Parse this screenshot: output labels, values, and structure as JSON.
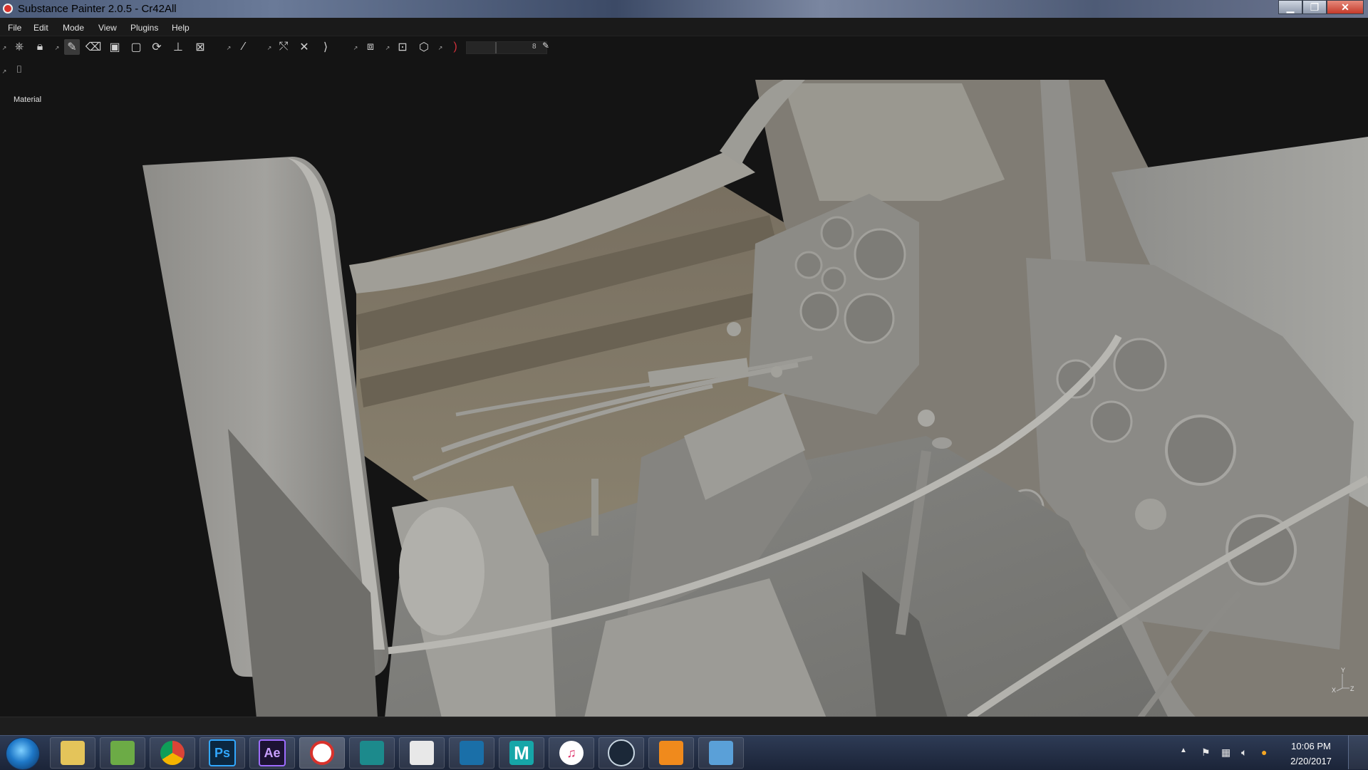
{
  "window": {
    "title": "Substance Painter 2.0.5 - Cr42All",
    "minimize": "▁",
    "maximize": "❐",
    "close": "✕"
  },
  "menu": [
    "File",
    "Edit",
    "Mode",
    "View",
    "Plugins",
    "Help"
  ],
  "toolbar": {
    "slider_value": "8"
  },
  "viewport": {
    "mode_label": "Material",
    "axis_labels": {
      "y": "Y",
      "x": "X",
      "z": "Z"
    }
  },
  "taskbar": {
    "apps": [
      {
        "name": "file-explorer",
        "label": ""
      },
      {
        "name": "notepad-app",
        "label": ""
      },
      {
        "name": "chrome",
        "label": ""
      },
      {
        "name": "photoshop",
        "label": "Ps"
      },
      {
        "name": "after-effects",
        "label": "Ae"
      },
      {
        "name": "substance-painter",
        "label": ""
      },
      {
        "name": "3ds-max",
        "label": ""
      },
      {
        "name": "zbrush",
        "label": ""
      },
      {
        "name": "video-player",
        "label": ""
      },
      {
        "name": "maya",
        "label": "M"
      },
      {
        "name": "itunes",
        "label": "♫"
      },
      {
        "name": "steam",
        "label": ""
      },
      {
        "name": "media-player",
        "label": ""
      },
      {
        "name": "photo-viewer",
        "label": ""
      }
    ],
    "clock_time": "10:06 PM",
    "clock_date": "2/20/2017"
  }
}
